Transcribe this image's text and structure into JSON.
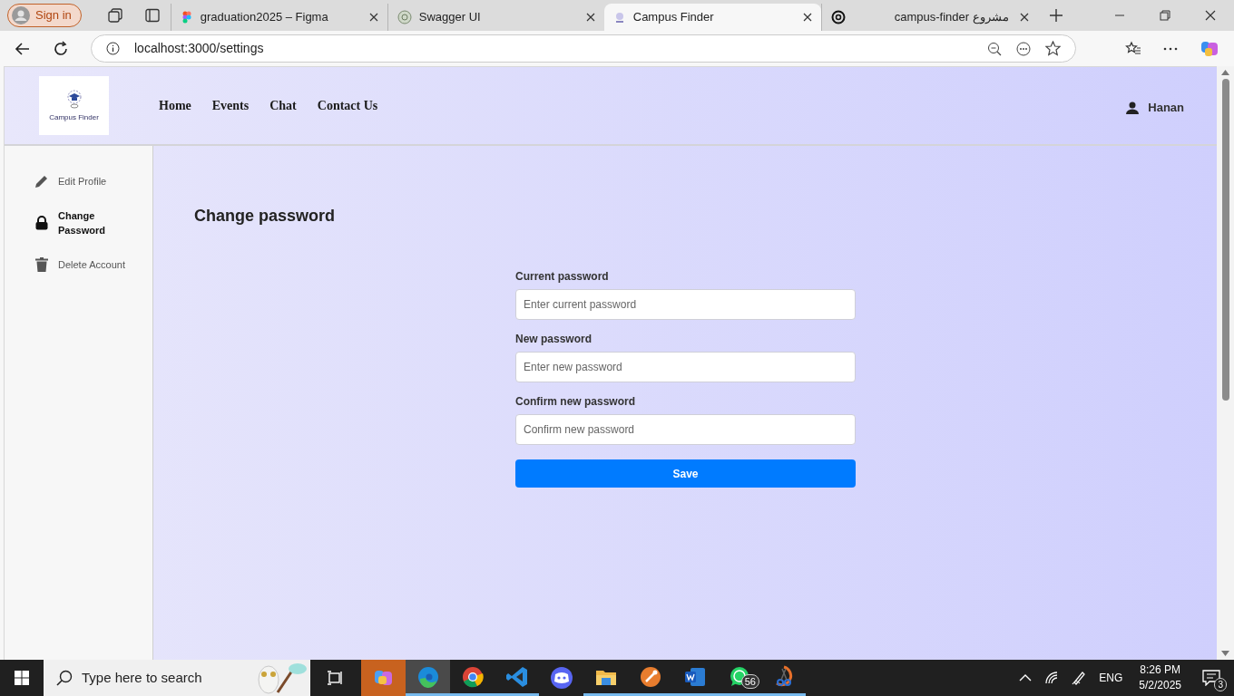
{
  "browser": {
    "sign_in": "Sign in",
    "tabs": [
      {
        "title": "graduation2025 – Figma",
        "selected": false,
        "kind": "figma"
      },
      {
        "title": "Swagger UI",
        "selected": false,
        "kind": "swagger"
      },
      {
        "title": "Campus Finder",
        "selected": true,
        "kind": "campus"
      },
      {
        "title": "campus-finder مشروع",
        "selected": false,
        "kind": "openai"
      }
    ],
    "address": "localhost:3000/settings"
  },
  "header": {
    "logo_text": "Campus Finder",
    "nav": [
      "Home",
      "Events",
      "Chat",
      "Contact Us"
    ],
    "user": "Hanan"
  },
  "sidebar": {
    "items": [
      {
        "label": "Edit Profile",
        "selected": false,
        "kind": "pencil"
      },
      {
        "label": "Change Password",
        "selected": true,
        "kind": "lock"
      },
      {
        "label": "Delete Account",
        "selected": false,
        "kind": "trash"
      }
    ]
  },
  "main": {
    "title": "Change password",
    "fields": [
      {
        "label": "Current password",
        "placeholder": "Enter current password"
      },
      {
        "label": "New password",
        "placeholder": "Enter new password"
      },
      {
        "label": "Confirm new password",
        "placeholder": "Confirm new password"
      }
    ],
    "save": "Save"
  },
  "taskbar": {
    "search_placeholder": "Type here to search",
    "apps": [
      {
        "kind": "copilot",
        "running": false
      },
      {
        "kind": "edge",
        "running": true
      },
      {
        "kind": "chrome",
        "running": true
      },
      {
        "kind": "code",
        "running": true
      },
      {
        "kind": "discord",
        "running": false
      },
      {
        "kind": "folder",
        "running": true
      },
      {
        "kind": "blender",
        "running": true
      },
      {
        "kind": "word",
        "running": true
      },
      {
        "kind": "whatsapp",
        "running": true,
        "badge": "56"
      },
      {
        "kind": "snip",
        "running": true
      }
    ],
    "language": "ENG",
    "time": "8:26 PM",
    "date": "5/2/2025",
    "notifications": "3"
  }
}
